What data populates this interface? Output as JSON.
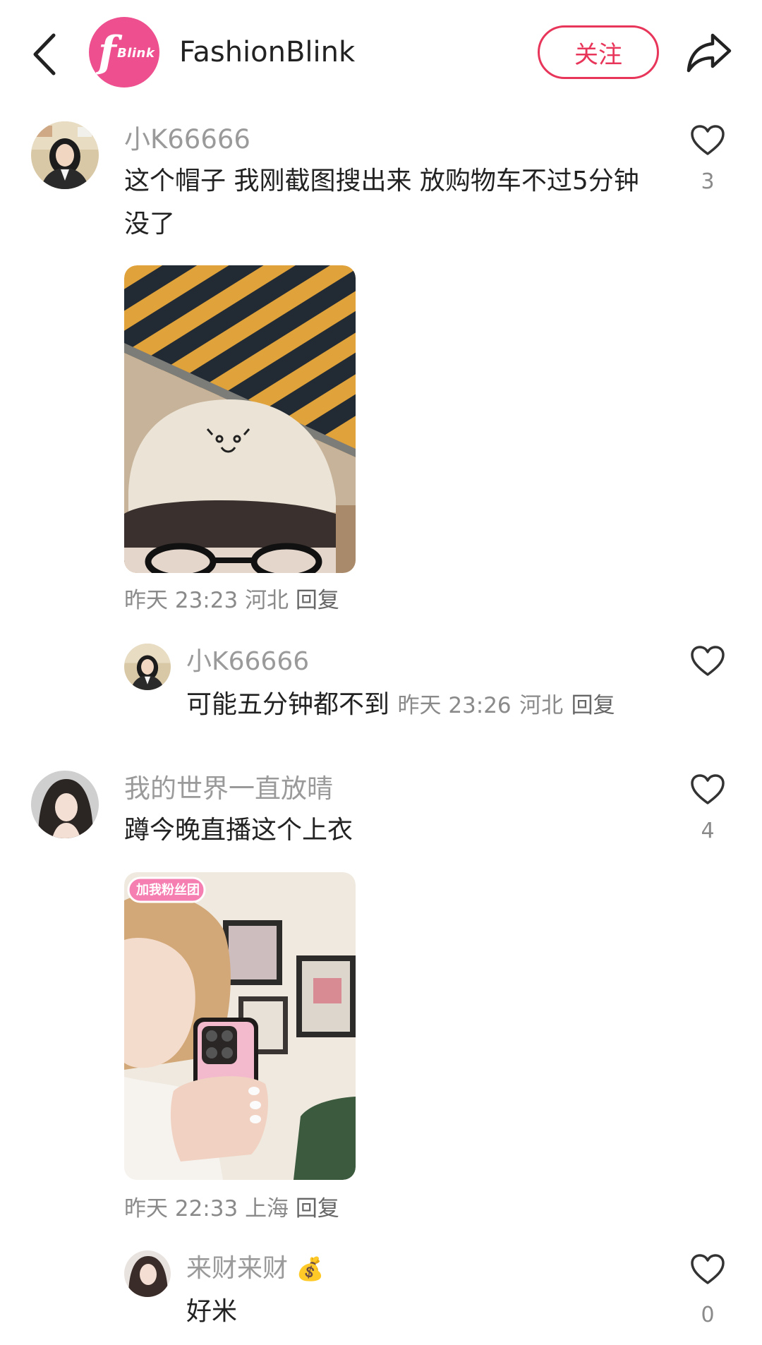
{
  "header": {
    "logo_mark": "f",
    "logo_text": "Blink",
    "account_name": "FashionBlink",
    "follow_label": "关注"
  },
  "comments": [
    {
      "username": "小K66666",
      "text": "这个帽子 我刚截图搜出来 放购物车不过5分钟 没了",
      "like_count": "3",
      "time": "昨天 23:23",
      "location": "河北",
      "reply_label": "回复",
      "reply": {
        "username": "小K66666",
        "text": "可能五分钟都不到",
        "time": "昨天 23:26",
        "location": "河北",
        "reply_label": "回复"
      }
    },
    {
      "username": "我的世界一直放晴",
      "text": "蹲今晚直播这个上衣",
      "like_count": "4",
      "time": "昨天 22:33",
      "location": "上海",
      "reply_label": "回复",
      "photo_sticker": "加我粉丝团",
      "reply": {
        "username": "来财来财",
        "username_emoji": "💰",
        "text": "好米",
        "like_count": "0"
      }
    }
  ],
  "colors": {
    "brand_pink": "#ee4f8e",
    "follow_red": "#e8355a",
    "username_gray": "#9a9a9a",
    "meta_gray": "#8a8a8a"
  },
  "icons": [
    "back-chevron-icon",
    "share-icon",
    "heart-icon"
  ]
}
